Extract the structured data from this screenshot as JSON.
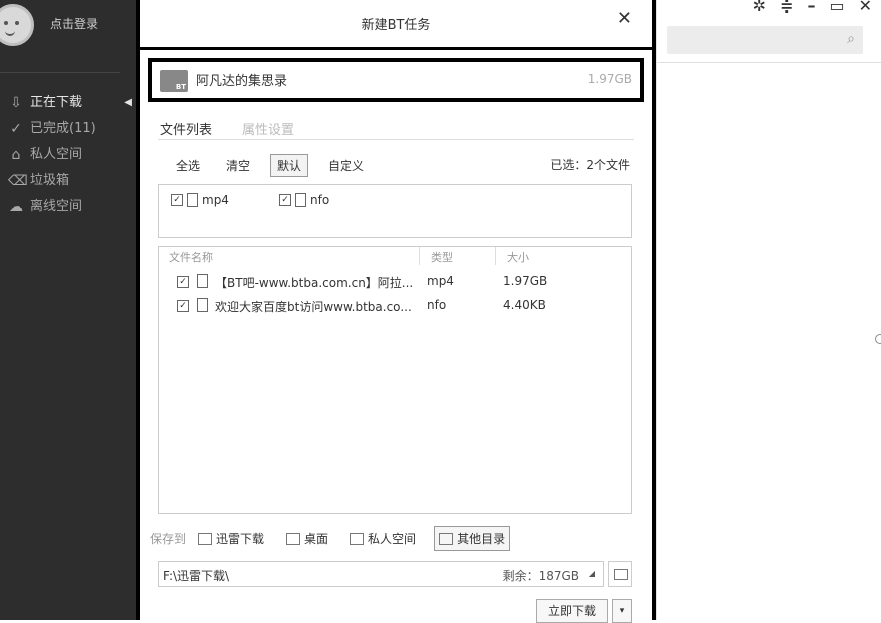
{
  "sidebar": {
    "login_label": "点击登录",
    "items": [
      {
        "icon": "download-icon",
        "label": "正在下载",
        "active": true
      },
      {
        "icon": "check-circle-icon",
        "label": "已完成(11)"
      },
      {
        "icon": "lock-icon",
        "label": "私人空间"
      },
      {
        "icon": "trash-icon",
        "label": "垃圾箱"
      },
      {
        "icon": "cloud-icon",
        "label": "离线空间"
      }
    ]
  },
  "dialog": {
    "title": "新建BT任务",
    "task": {
      "name": "阿凡达的集思录",
      "size": "1.97GB",
      "icon_label": "BT"
    },
    "tabs": [
      "文件列表",
      "属性设置"
    ],
    "select_buttons": [
      "全选",
      "清空",
      "默认",
      "自定义"
    ],
    "selected_count": "已选：2个文件",
    "file_types": [
      "mp4",
      "nfo"
    ],
    "table": {
      "headers": [
        "文件名称",
        "类型",
        "大小"
      ],
      "rows": [
        {
          "name": "【BT吧-www.btba.com.cn】阿拉...",
          "type": "mp4",
          "size": "1.97GB"
        },
        {
          "name": "欢迎大家百度bt访问www.btba.co...",
          "type": "nfo",
          "size": "4.40KB"
        }
      ]
    },
    "save": {
      "label": "保存到",
      "locations": [
        "迅雷下载",
        "桌面",
        "私人空间",
        "其他目录"
      ]
    },
    "path": "F:\\迅雷下载\\",
    "remaining": "剩余：187GB",
    "download_button": "立即下载"
  },
  "window": {
    "controls": [
      "✲",
      "≑",
      "–",
      "▭",
      "✕"
    ]
  }
}
